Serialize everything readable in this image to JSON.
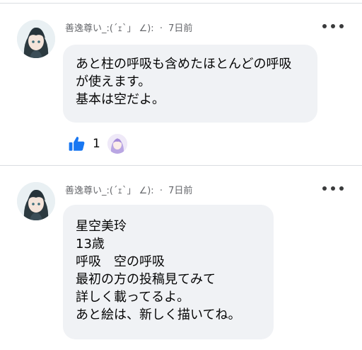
{
  "posts": [
    {
      "author": "善逸尊い_:(´ｪ`」 ∠):",
      "separator": "·",
      "time": "7日前",
      "text_lines": [
        "あと柱の呼吸も含めたほとんどの呼吸",
        "が使えます。",
        "基本は空だよ。"
      ],
      "like_count": "1"
    },
    {
      "author": "善逸尊い_:(´ｪ`」 ∠):",
      "separator": "·",
      "time": "7日前",
      "text_lines": [
        "星空美玲",
        "13歳",
        "呼吸　空の呼吸",
        "最初の方の投稿見てみて",
        "詳しく載ってるよ。",
        "あと絵は、新しく描いてね。"
      ]
    }
  ],
  "colors": {
    "like_blue": "#1877f2",
    "bubble_bg": "#f0f2f5",
    "meta_text": "#65676b"
  },
  "icons": {
    "like": "thumbs-up-icon",
    "more": "more-options-icon"
  }
}
